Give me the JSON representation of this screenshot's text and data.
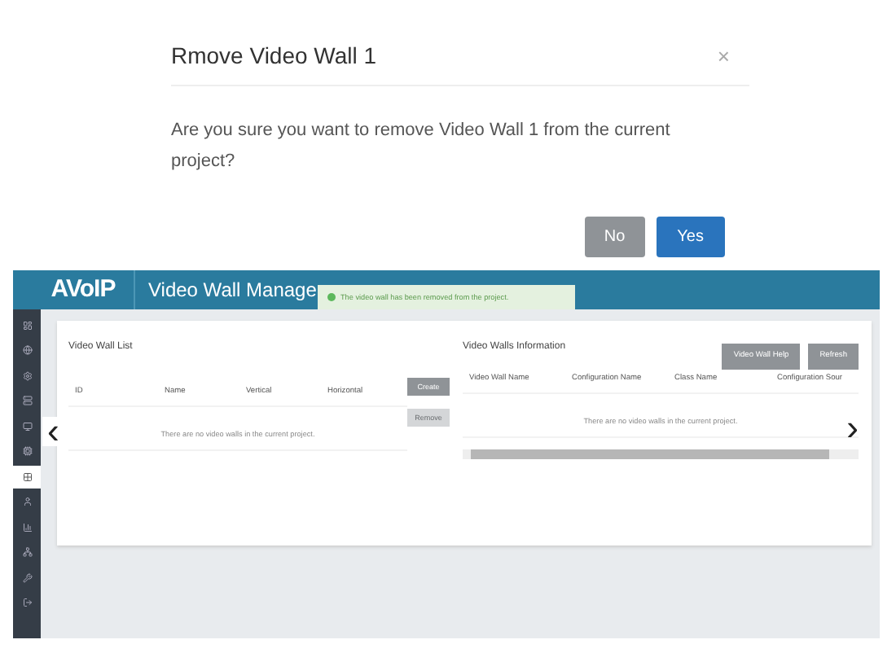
{
  "dialog": {
    "title": "Rmove Video Wall 1",
    "close": "×",
    "message": "Are you sure you want to remove Video Wall 1 from the current project?",
    "buttons": [
      {
        "label": "No",
        "kind": "secondary"
      },
      {
        "label": "Yes",
        "kind": "primary"
      }
    ]
  },
  "app": {
    "logo": "AVoIP",
    "title": "Video Wall Manage",
    "toast": {
      "message": "The video wall has been removed from the project."
    },
    "sidebar": {
      "items": [
        {
          "selected": false
        },
        {
          "selected": false
        },
        {
          "selected": false
        },
        {
          "selected": false
        },
        {
          "selected": false
        },
        {
          "selected": false
        },
        {
          "selected": true
        },
        {
          "selected": false
        },
        {
          "selected": false
        },
        {
          "selected": false
        },
        {
          "selected": false
        },
        {
          "selected": false
        }
      ]
    },
    "list_panel": {
      "title": "Video Wall List",
      "columns": [
        "ID",
        "Name",
        "Vertical",
        "Horizontal"
      ],
      "empty_message": "There are no video walls in the current project.",
      "buttons": [
        {
          "label": "Create",
          "disabled": false
        },
        {
          "label": "Remove",
          "disabled": true
        }
      ]
    },
    "info_panel": {
      "title": "Video Walls Information",
      "buttons": [
        "Video Wall Help",
        "Refresh"
      ],
      "columns": [
        "Video Wall Name",
        "Configuration Name",
        "Class Name",
        "Configuration Sour"
      ],
      "empty_message": "There are no video walls in the current project."
    },
    "prev": "‹",
    "next": "›"
  }
}
